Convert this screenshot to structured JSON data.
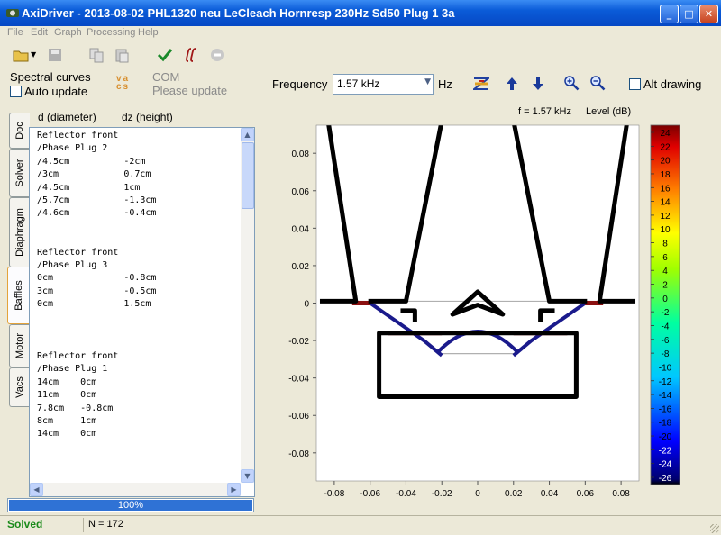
{
  "window": {
    "title": "AxiDriver - 2013-08-02 PHL1320 neu LeCleach Hornresp 230Hz Sd50 Plug 1 3a",
    "min_glyph": "_",
    "max_glyph": "□",
    "close_glyph": "✕"
  },
  "menu": [
    "File",
    "Edit",
    "Graph",
    "Processing",
    "Help"
  ],
  "toolbar_icons": [
    "open-folder-icon",
    "save-icon",
    "copy-icon",
    "paste-icon",
    "checkmark-icon",
    "integral-icon",
    "stop-icon"
  ],
  "left_panel": {
    "spectral_label": "Spectral curves",
    "auto_update_label": "Auto update",
    "auto_update_checked": false,
    "vacs_logo": "vacs",
    "com_label": "COM",
    "please_update_label": "Please update",
    "col_d_label": "d (diameter)",
    "col_dz_label": "dz (height)",
    "tabs": [
      "Doc",
      "Solver",
      "Diaphragm",
      "Baffles",
      "Motor",
      "Vacs"
    ],
    "active_tab": "Baffles",
    "code_text": "Reflector front\n/Phase Plug 2\n/4.5cm          -2cm\n/3cm            0.7cm\n/4.5cm          1cm\n/5.7cm          -1.3cm\n/4.6cm          -0.4cm\n\n\nReflector front\n/Phase Plug 3\n0cm             -0.8cm\n3cm             -0.5cm\n0cm             1.5cm\n\n\n\nReflector front\n/Phase Plug 1\n14cm    0cm\n11cm    0cm\n7.8cm   -0.8cm\n8cm     1cm\n14cm    0cm",
    "progress_label": "100%",
    "progress_value": 1.0
  },
  "controls": {
    "frequency_label": "Frequency",
    "frequency_value": "1.57 kHz",
    "unit_label": "Hz",
    "alt_drawing_label": "Alt drawing",
    "alt_drawing_checked": false
  },
  "status": {
    "state": "Solved",
    "n_label": "N = 172",
    "state_color": "#1a8a1a"
  },
  "chart_data": {
    "type": "cross-section with level colorbar",
    "plot_title": "f = 1.57 kHz",
    "colorbar_title": "Level  (dB)",
    "x_ticks": [
      "-0.08",
      "-0.06",
      "-0.04",
      "-0.02",
      "0",
      "0.02",
      "0.04",
      "0.06",
      "0.08"
    ],
    "y_ticks": [
      "0.08",
      "0.06",
      "0.04",
      "0.02",
      "0",
      "-0.02",
      "-0.04",
      "-0.06",
      "-0.08"
    ],
    "xlim": [
      -0.09,
      0.09
    ],
    "ylim": [
      -0.095,
      0.095
    ],
    "colorbar_ticks": [
      "24",
      "22",
      "20",
      "18",
      "16",
      "14",
      "12",
      "10",
      "8",
      "6",
      "4",
      "2",
      "0",
      "-2",
      "-4",
      "-6",
      "-8",
      "-10",
      "-12",
      "-14",
      "-16",
      "-18",
      "-20",
      "-22",
      "-24",
      "-26"
    ],
    "colorbar_range": [
      -26,
      24
    ],
    "colors": {
      "baffle": "#000000",
      "diaphragm": "#1a1a8c",
      "surround": "#8b1010",
      "axis_line": "#b0b0b0"
    },
    "baffle_right_horn": [
      [
        0.018,
        0.107
      ],
      [
        0.04,
        0.001
      ],
      [
        0.061,
        0.001
      ]
    ],
    "baffle_right_wall": [
      [
        0.085,
        0.107
      ],
      [
        0.068,
        0.001
      ],
      [
        0.088,
        0.001
      ]
    ],
    "baffle_left_horn": [
      [
        -0.018,
        0.107
      ],
      [
        -0.04,
        0.001
      ],
      [
        -0.061,
        0.001
      ]
    ],
    "baffle_left_wall": [
      [
        -0.085,
        0.107
      ],
      [
        -0.068,
        0.001
      ],
      [
        -0.088,
        0.001
      ]
    ],
    "baffle_top_line": [
      [
        -0.083,
        0.001
      ],
      [
        0.083,
        0.001
      ]
    ],
    "phase_plug": [
      [
        -0.014,
        -0.006
      ],
      [
        0,
        0.006
      ],
      [
        0.014,
        -0.006
      ],
      [
        0,
        -0.001
      ]
    ],
    "motor_box": [
      [
        -0.055,
        -0.016
      ],
      [
        0.055,
        -0.016
      ],
      [
        0.055,
        -0.05
      ],
      [
        -0.055,
        -0.05
      ]
    ],
    "surround_left": [
      [
        -0.05,
        -0.016
      ],
      [
        -0.02,
        -0.016
      ]
    ],
    "surround_right": [
      [
        0.02,
        -0.016
      ],
      [
        0.05,
        -0.016
      ]
    ],
    "surround_top_left": [
      [
        -0.07,
        0.0
      ],
      [
        -0.06,
        0.0
      ]
    ],
    "surround_top_right": [
      [
        0.06,
        0.0
      ],
      [
        0.07,
        0.0
      ]
    ],
    "diaphragm_left": [
      [
        -0.06,
        0.0
      ],
      [
        -0.045,
        -0.01
      ],
      [
        -0.03,
        -0.02
      ],
      [
        -0.02,
        -0.028
      ]
    ],
    "diaphragm_right": [
      [
        0.06,
        0.0
      ],
      [
        0.045,
        -0.01
      ],
      [
        0.03,
        -0.02
      ],
      [
        0.02,
        -0.028
      ]
    ],
    "dome": [
      [
        -0.022,
        -0.026
      ],
      [
        0,
        -0.011
      ],
      [
        0.022,
        -0.026
      ]
    ],
    "dome_base": [
      [
        -0.022,
        -0.027
      ],
      [
        0.022,
        -0.027
      ]
    ],
    "corner_left": [
      [
        -0.043,
        -0.004
      ],
      [
        -0.035,
        -0.004
      ],
      [
        -0.035,
        -0.01
      ]
    ],
    "corner_right": [
      [
        0.043,
        -0.004
      ],
      [
        0.035,
        -0.004
      ],
      [
        0.035,
        -0.01
      ]
    ]
  }
}
